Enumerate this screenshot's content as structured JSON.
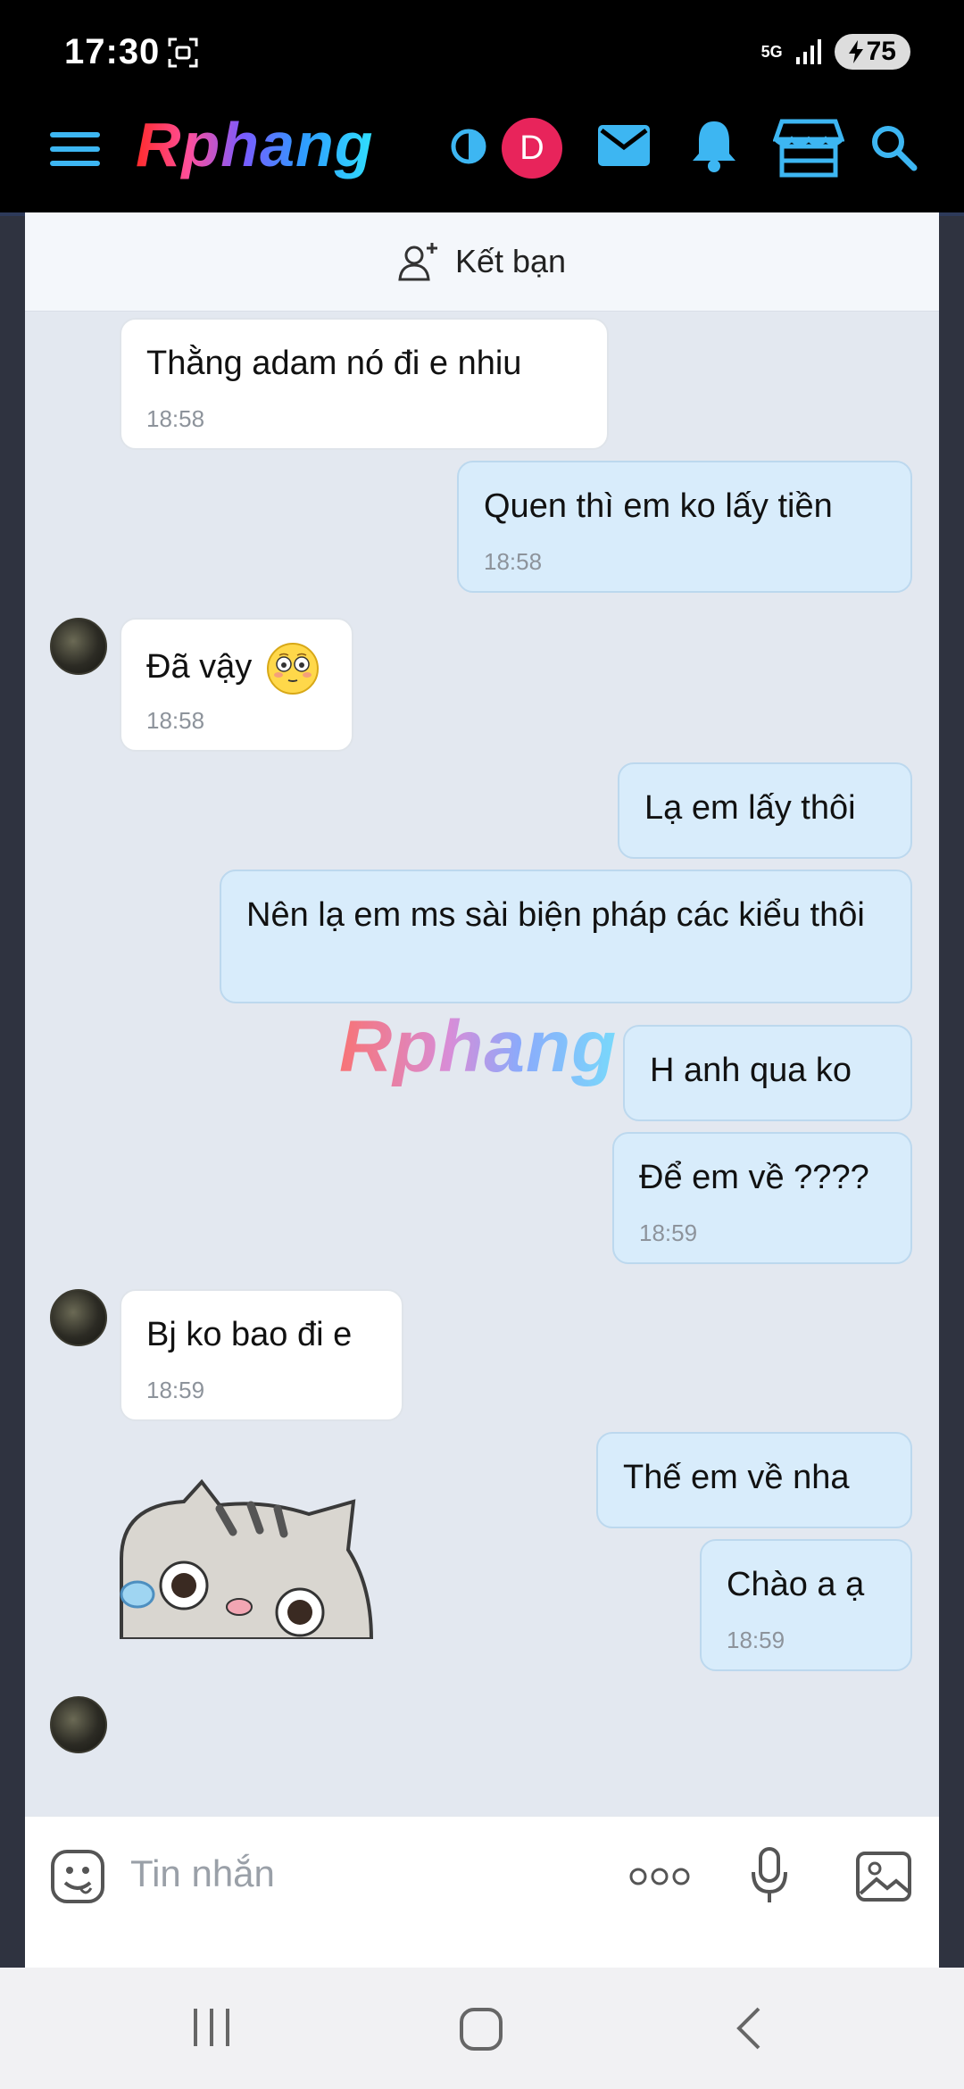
{
  "status_bar": {
    "time": "17:30",
    "network": "5G",
    "battery": "75"
  },
  "header": {
    "logo": "Rphang",
    "avatar_letter": "D"
  },
  "chat": {
    "add_friend_label": "Kết bạn",
    "watermark": "Rphang",
    "messages": [
      {
        "side": "in",
        "text": "Thằng adam nó đi e nhiu",
        "time": "18:58"
      },
      {
        "side": "out",
        "text": "Quen thì em ko lấy tiền",
        "time": "18:58"
      },
      {
        "side": "in",
        "text": "Đã vậy",
        "time": "18:58",
        "emoji": "flushed-face"
      },
      {
        "side": "out",
        "text": "Lạ em lấy thôi",
        "time": ""
      },
      {
        "side": "out",
        "text": "Nên lạ em ms sài biện pháp các kiểu thôi",
        "time": ""
      },
      {
        "side": "out",
        "text": "H anh qua ko",
        "time": ""
      },
      {
        "side": "out",
        "text": "Để em về ????",
        "time": "18:59"
      },
      {
        "side": "in",
        "text": "Bj ko bao đi e",
        "time": "18:59"
      },
      {
        "side": "out",
        "text": "Thế em về nha",
        "time": ""
      },
      {
        "side": "out",
        "text": "Chào a ạ",
        "time": "18:59"
      }
    ]
  },
  "composer": {
    "placeholder": "Tin nhắn"
  },
  "colors": {
    "accent": "#3db6f2",
    "incoming_bubble": "#ffffff",
    "outgoing_bubble": "#d8ecfb",
    "chat_bg": "#e3e8f0",
    "badge": "#e8245b"
  }
}
